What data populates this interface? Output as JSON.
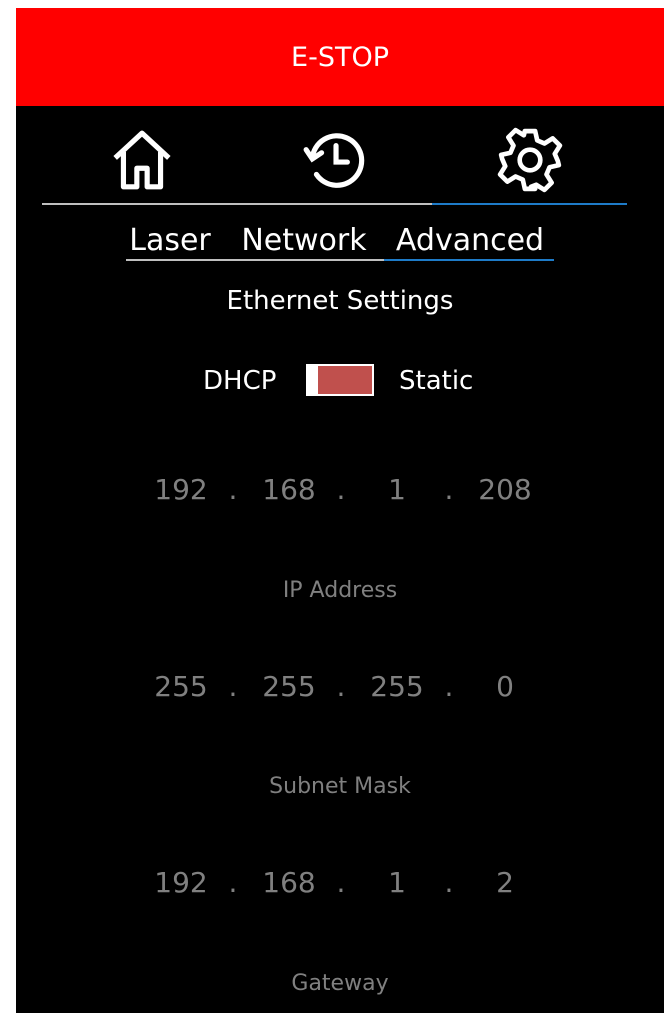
{
  "estop": {
    "label": "E-STOP",
    "color": "#ff0000"
  },
  "nav": {
    "icons": [
      "home-icon",
      "history-icon",
      "gear-icon"
    ],
    "active_index": 2,
    "active_color": "#1e7bc8"
  },
  "subtabs": {
    "items": [
      "Laser",
      "Network",
      "Advanced"
    ],
    "active_index": 2
  },
  "ethernet": {
    "title": "Ethernet Settings",
    "mode_left": "DHCP",
    "mode_right": "Static",
    "toggle_color": "#c0504d",
    "separator": ".",
    "ip": {
      "label": "IP Address",
      "octets": [
        "192",
        "168",
        "1",
        "208"
      ]
    },
    "subnet": {
      "label": "Subnet Mask",
      "octets": [
        "255",
        "255",
        "255",
        "0"
      ]
    },
    "gateway": {
      "label": "Gateway",
      "octets": [
        "192",
        "168",
        "1",
        "2"
      ]
    }
  }
}
